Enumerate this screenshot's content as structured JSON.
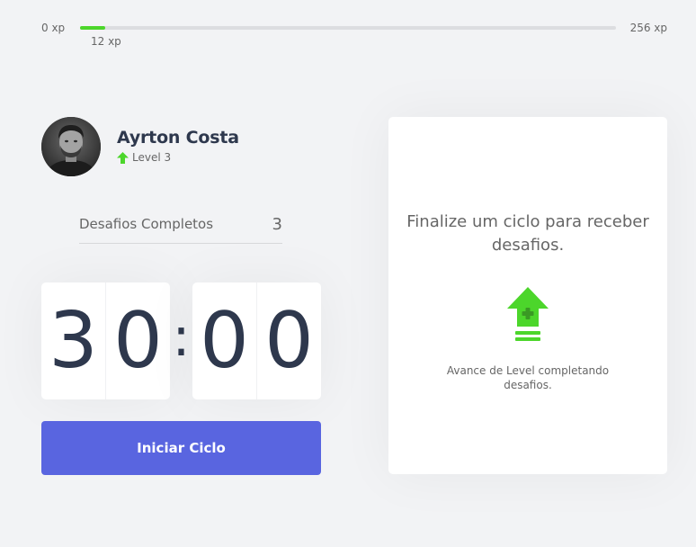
{
  "experience": {
    "min_label": "0 xp",
    "max_label": "256 xp",
    "current_label": "12 xp",
    "current_xp": 12,
    "next_level_xp": 256,
    "bar_color": "#4cd62b"
  },
  "profile": {
    "name": "Ayrton Costa",
    "level_label": "Level 3",
    "level_icon": "level-up-arrow-icon"
  },
  "completed_challenges": {
    "label": "Desafios Completos",
    "count": "3"
  },
  "countdown": {
    "minute_left": "3",
    "minute_right": "0",
    "separator": ":",
    "second_left": "0",
    "second_right": "0"
  },
  "start_button": {
    "label": "Iniciar Ciclo",
    "color": "#5965e0"
  },
  "challenge_box": {
    "title": "Finalize um ciclo para receber desafios.",
    "icon": "level-up-icon",
    "hint": "Avance de Level completando desafios."
  },
  "colors": {
    "background": "#f2f3f5",
    "title_text": "#2e384d",
    "body_text": "#666666",
    "green": "#4cd62b",
    "blue": "#5965e0"
  }
}
